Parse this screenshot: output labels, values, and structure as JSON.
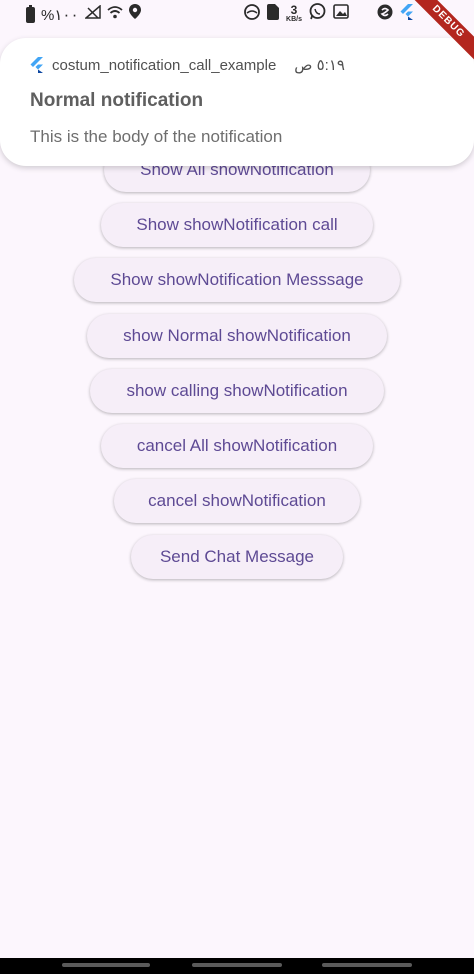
{
  "status_bar": {
    "battery_text": "%١٠٠",
    "speed_value": "3",
    "speed_unit": "KB/s",
    "debug_label": "DEBUG",
    "icons": [
      "battery-icon",
      "signal-icon",
      "wifi-icon",
      "location-icon",
      "tethering-icon",
      "sim-icon",
      "whatsapp-icon",
      "gallery-icon",
      "app-icon",
      "flutter-icon"
    ]
  },
  "notification": {
    "app_name": "costum_notification_call_example",
    "time": "٥:١٩ ص",
    "title": "Normal notification",
    "body": "This is the body of the notification"
  },
  "buttons": [
    {
      "label": "Show All showNotification"
    },
    {
      "label": "Show showNotification call"
    },
    {
      "label": "Show showNotification Messsage"
    },
    {
      "label": "show Normal showNotification"
    },
    {
      "label": "show calling showNotification"
    },
    {
      "label": "cancel All showNotification"
    },
    {
      "label": "cancel showNotification"
    },
    {
      "label": "Send Chat Message"
    }
  ],
  "colors": {
    "background": "#fcf6fd",
    "button_bg": "#f6eef8",
    "button_text": "#5e4a94",
    "debug_banner": "#b3261e"
  }
}
